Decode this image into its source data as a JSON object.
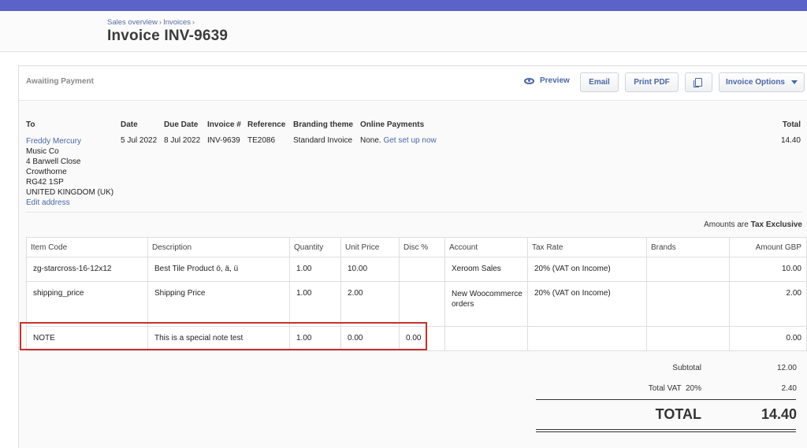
{
  "header": {
    "breadcrumb": [
      "Sales overview",
      "Invoices"
    ],
    "title": "Invoice INV-9639"
  },
  "toolbar": {
    "status": "Awaiting Payment",
    "preview_label": "Preview",
    "email_label": "Email",
    "print_label": "Print PDF",
    "options_label": "Invoice Options"
  },
  "info": {
    "to_label": "To",
    "date_label": "Date",
    "due_label": "Due Date",
    "invoice_no_label": "Invoice #",
    "reference_label": "Reference",
    "theme_label": "Branding theme",
    "payments_label": "Online Payments",
    "total_label": "Total",
    "contact_name": "Freddy Mercury",
    "address": [
      "Music Co",
      "4 Barwell Close",
      "Crowthorne",
      "RG42 1SP",
      "UNITED KINGDOM (UK)"
    ],
    "edit_address": "Edit address",
    "date": "5 Jul 2022",
    "due_date": "8 Jul 2022",
    "invoice_no": "INV-9639",
    "reference": "TE2086",
    "theme": "Standard Invoice",
    "payments_status": "None.",
    "payments_link": "Get set up now",
    "total": "14.40"
  },
  "tax_note": {
    "prefix": "Amounts are",
    "mode": "Tax Exclusive"
  },
  "table": {
    "headers": [
      "Item Code",
      "Description",
      "Quantity",
      "Unit Price",
      "Disc %",
      "Account",
      "Tax Rate",
      "Brands",
      "Amount GBP"
    ],
    "rows": [
      {
        "code": "zg-starcross-16-12x12",
        "description": "Best Tile Product ö, ä, ü",
        "quantity": "1.00",
        "unit_price": "10.00",
        "disc": "",
        "account": "Xeroom Sales",
        "tax_rate": "20% (VAT on Income)",
        "brands": "",
        "amount": "10.00"
      },
      {
        "code": "shipping_price",
        "description": "Shipping Price",
        "quantity": "1.00",
        "unit_price": "2.00",
        "disc": "",
        "account": "New Woocommerce orders",
        "tax_rate": "20% (VAT on Income)",
        "brands": "",
        "amount": "2.00"
      },
      {
        "code": "NOTE",
        "description": "This is a special note test",
        "quantity": "1.00",
        "unit_price": "0.00",
        "disc": "0.00",
        "account": "",
        "tax_rate": "",
        "brands": "",
        "amount": "0.00"
      }
    ]
  },
  "totals": {
    "subtotal_label": "Subtotal",
    "subtotal": "12.00",
    "vat_label": "Total VAT  20%",
    "vat": "2.40",
    "total_label": "TOTAL",
    "total": "14.40"
  },
  "colors": {
    "topbar": "#5b63c8",
    "link": "#4a66a8",
    "highlight": "#c9302c"
  }
}
